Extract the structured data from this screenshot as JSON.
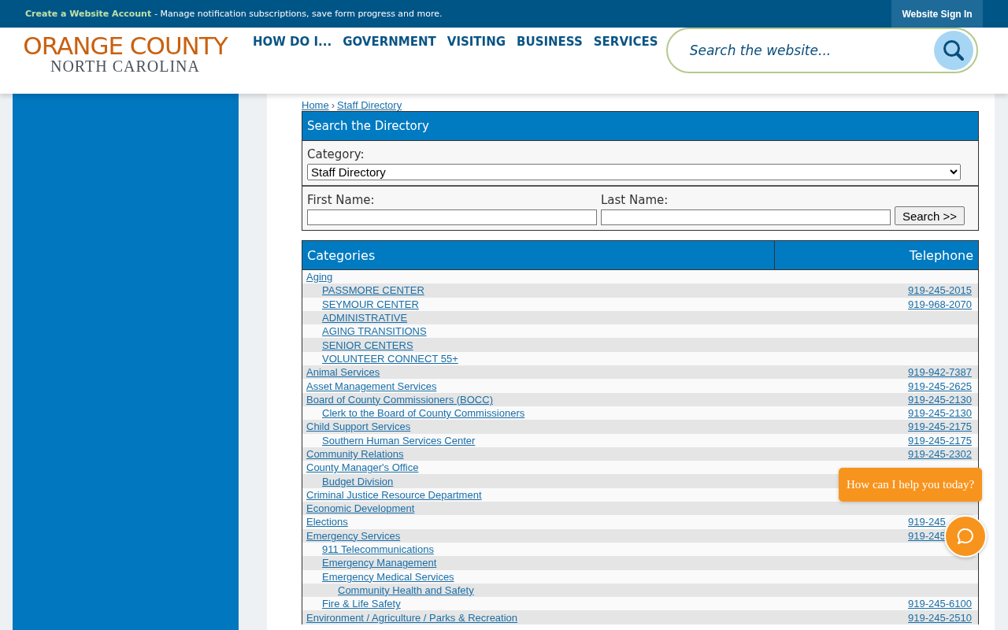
{
  "top_bar": {
    "account_link": "Create a Website Account",
    "message": "- Manage notification subscriptions, save form progress and more.",
    "sign_in": "Website Sign In"
  },
  "logo": {
    "line1": "ORANGE COUNTY",
    "line2": "NORTH CAROLINA"
  },
  "nav": [
    "HOW DO I...",
    "GOVERNMENT",
    "VISITING",
    "BUSINESS",
    "SERVICES"
  ],
  "site_search": {
    "placeholder": "Search the website..."
  },
  "breadcrumb": {
    "separator": "›",
    "items": [
      "Home",
      "Staff Directory"
    ]
  },
  "directory_search": {
    "title": "Search the Directory",
    "category_label": "Category:",
    "category_value": "Staff Directory",
    "first_name_label": "First Name:",
    "last_name_label": "Last Name:",
    "button": "Search >>"
  },
  "table": {
    "columns": [
      "Categories",
      "Telephone"
    ],
    "rows": [
      {
        "name": "Aging",
        "children": [
          {
            "name": "PASSMORE CENTER",
            "phone": "919-245-2015"
          },
          {
            "name": "SEYMOUR CENTER",
            "phone": "919-968-2070"
          },
          {
            "name": "ADMINISTRATIVE"
          },
          {
            "name": "AGING TRANSITIONS"
          },
          {
            "name": "SENIOR CENTERS"
          },
          {
            "name": "VOLUNTEER CONNECT 55+"
          }
        ]
      },
      {
        "name": "Animal Services",
        "phone": "919-942-7387"
      },
      {
        "name": "Asset Management Services",
        "phone": "919-245-2625"
      },
      {
        "name": "Board of County Commissioners (BOCC)",
        "phone": "919-245-2130",
        "children": [
          {
            "name": "Clerk to the Board of County Commissioners",
            "phone": "919-245-2130"
          }
        ]
      },
      {
        "name": "Child Support Services",
        "phone": "919-245-2175",
        "children": [
          {
            "name": "Southern Human Services Center",
            "phone": "919-245-2175"
          }
        ]
      },
      {
        "name": "Community Relations",
        "phone": "919-245-2302"
      },
      {
        "name": "County Manager's Office",
        "children": [
          {
            "name": "Budget Division"
          }
        ]
      },
      {
        "name": "Criminal Justice Resource Department"
      },
      {
        "name": "Economic Development"
      },
      {
        "name": "Elections",
        "phone": "919-245"
      },
      {
        "name": "Emergency Services",
        "phone": "919-245",
        "children": [
          {
            "name": "911 Telecommunications"
          },
          {
            "name": "Emergency Management"
          },
          {
            "name": "Emergency Medical Services",
            "children": [
              {
                "name": "Community Health and Safety"
              }
            ]
          },
          {
            "name": "Fire & Life Safety",
            "phone": "919-245-6100"
          }
        ]
      },
      {
        "name": "Environment / Agriculture / Parks & Recreation",
        "phone": "919-245-2510"
      }
    ]
  },
  "chat": {
    "prompt": "How can I help you today?"
  }
}
